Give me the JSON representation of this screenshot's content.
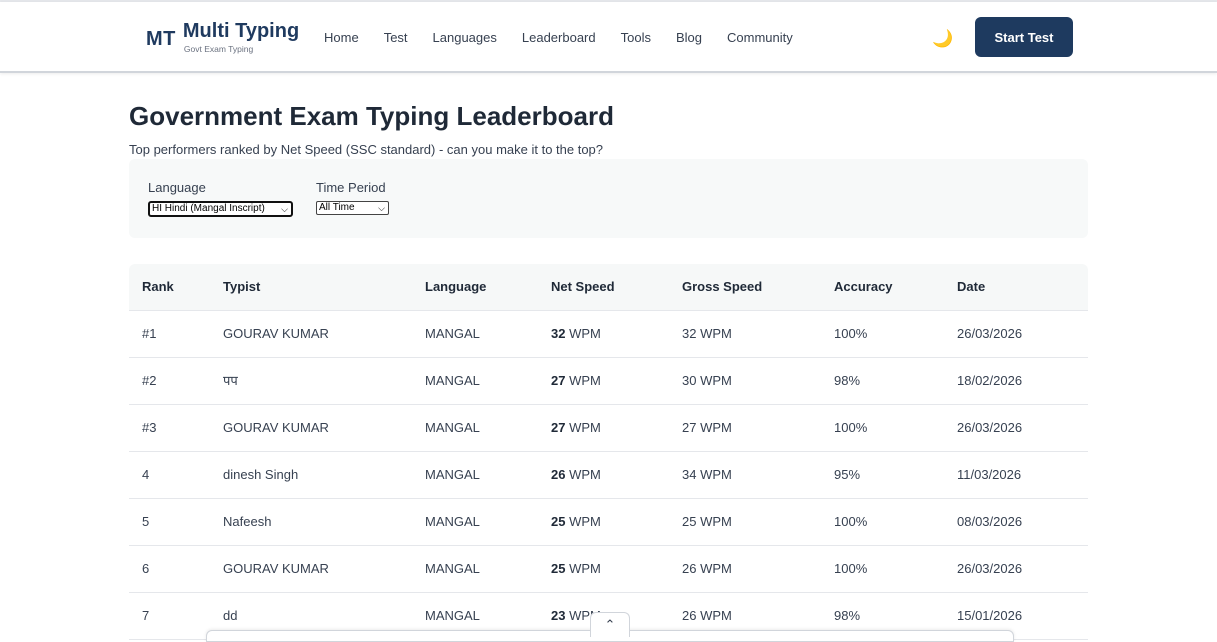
{
  "brand": {
    "mark": "MT",
    "title": "Multi Typing",
    "subtitle": "Govt Exam Typing"
  },
  "nav": [
    "Home",
    "Test",
    "Languages",
    "Leaderboard",
    "Tools",
    "Blog",
    "Community"
  ],
  "theme_icon": "moon-icon",
  "start_button": "Start Test",
  "page": {
    "title": "Government Exam Typing Leaderboard",
    "subtitle": "Top performers ranked by Net Speed (SSC standard) - can you make it to the top?"
  },
  "filters": {
    "language_label": "Language",
    "language_value": "HI Hindi (Mangal Inscript)",
    "period_label": "Time Period",
    "period_value": "All Time"
  },
  "table": {
    "headers": [
      "Rank",
      "Typist",
      "Language",
      "Net Speed",
      "Gross Speed",
      "Accuracy",
      "Date"
    ],
    "rows": [
      {
        "rank": "#1",
        "typist": "GOURAV KUMAR",
        "language": "MANGAL",
        "net": "32",
        "net_unit": "WPM",
        "gross": "32 WPM",
        "accuracy": "100%",
        "date": "26/03/2026"
      },
      {
        "rank": "#2",
        "typist": "पप",
        "language": "MANGAL",
        "net": "27",
        "net_unit": "WPM",
        "gross": "30 WPM",
        "accuracy": "98%",
        "date": "18/02/2026"
      },
      {
        "rank": "#3",
        "typist": "GOURAV KUMAR",
        "language": "MANGAL",
        "net": "27",
        "net_unit": "WPM",
        "gross": "27 WPM",
        "accuracy": "100%",
        "date": "26/03/2026"
      },
      {
        "rank": "4",
        "typist": "dinesh Singh",
        "language": "MANGAL",
        "net": "26",
        "net_unit": "WPM",
        "gross": "34 WPM",
        "accuracy": "95%",
        "date": "11/03/2026"
      },
      {
        "rank": "5",
        "typist": "Nafeesh",
        "language": "MANGAL",
        "net": "25",
        "net_unit": "WPM",
        "gross": "25 WPM",
        "accuracy": "100%",
        "date": "08/03/2026"
      },
      {
        "rank": "6",
        "typist": "GOURAV KUMAR",
        "language": "MANGAL",
        "net": "25",
        "net_unit": "WPM",
        "gross": "26 WPM",
        "accuracy": "100%",
        "date": "26/03/2026"
      },
      {
        "rank": "7",
        "typist": "dd",
        "language": "MANGAL",
        "net": "23",
        "net_unit": "WPM",
        "gross": "26 WPM",
        "accuracy": "98%",
        "date": "15/01/2026"
      }
    ]
  },
  "colors": {
    "brand": "#1e3a5f",
    "panel": "#f6f8f8",
    "border": "#e5e7eb"
  }
}
